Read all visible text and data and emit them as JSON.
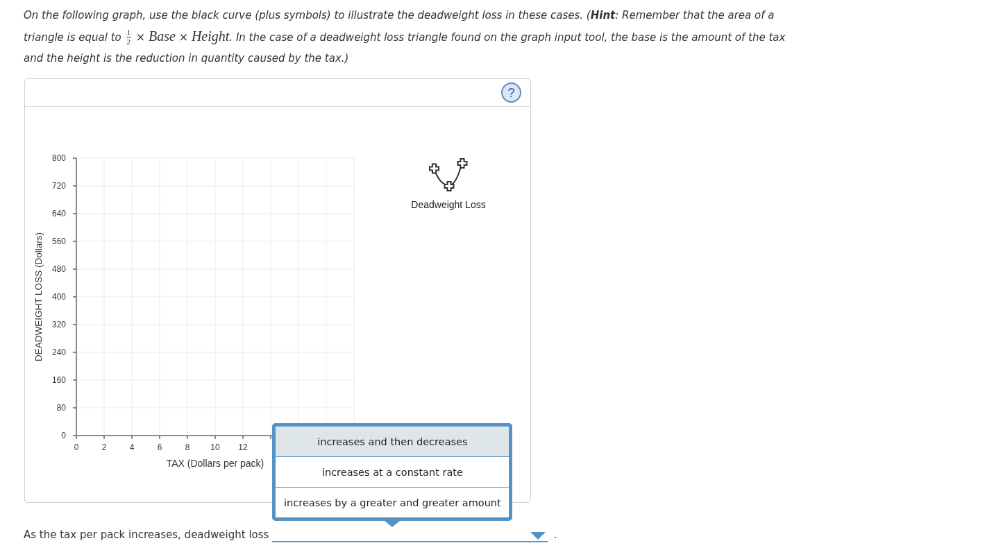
{
  "instructions": {
    "text_before": "On the following graph, use the black curve (plus symbols) to illustrate the deadweight loss in these cases. (**Hint**: Remember that the area of a triangle is equal to",
    "formula": [
      {
        "kind": "fraction",
        "numerator": "1",
        "denominator": "2"
      },
      {
        "kind": "operator",
        "text": "×"
      },
      {
        "kind": "variable",
        "text": "Base"
      },
      {
        "kind": "operator",
        "text": "×"
      },
      {
        "kind": "variable",
        "text": "Height"
      }
    ],
    "text_after": ". In the case of a deadweight loss triangle found on the graph input tool, the base is the amount of the tax and the height is the reduction in quantity caused by the tax.)"
  },
  "graph_panel": {
    "help_button": "?",
    "chart_data": [
      {
        "type": "line",
        "xlabel": "TAX (Dollars per pack)",
        "ylabel": "DEADWEIGHT LOSS (Dollars)",
        "xlim": [
          0,
          20
        ],
        "ylim": [
          0,
          800
        ],
        "xticks": [
          0,
          2,
          4,
          6,
          8,
          10,
          12
        ],
        "yticks": [
          0,
          80,
          160,
          240,
          320,
          400,
          480,
          560,
          640,
          720,
          800
        ],
        "grid": true
      }
    ],
    "tools": [
      {
        "label": "Deadweight Loss"
      }
    ]
  },
  "question": {
    "prefix": "As the tax per pack increases, deadweight loss",
    "dropdown": {
      "open": true,
      "options": [
        {
          "text": "increases and then decreases",
          "selected": true
        },
        {
          "text": "increases at a constant rate",
          "selected": false
        },
        {
          "text": "increases by a greater and greater amount",
          "selected": false
        }
      ]
    },
    "suffix": "."
  }
}
